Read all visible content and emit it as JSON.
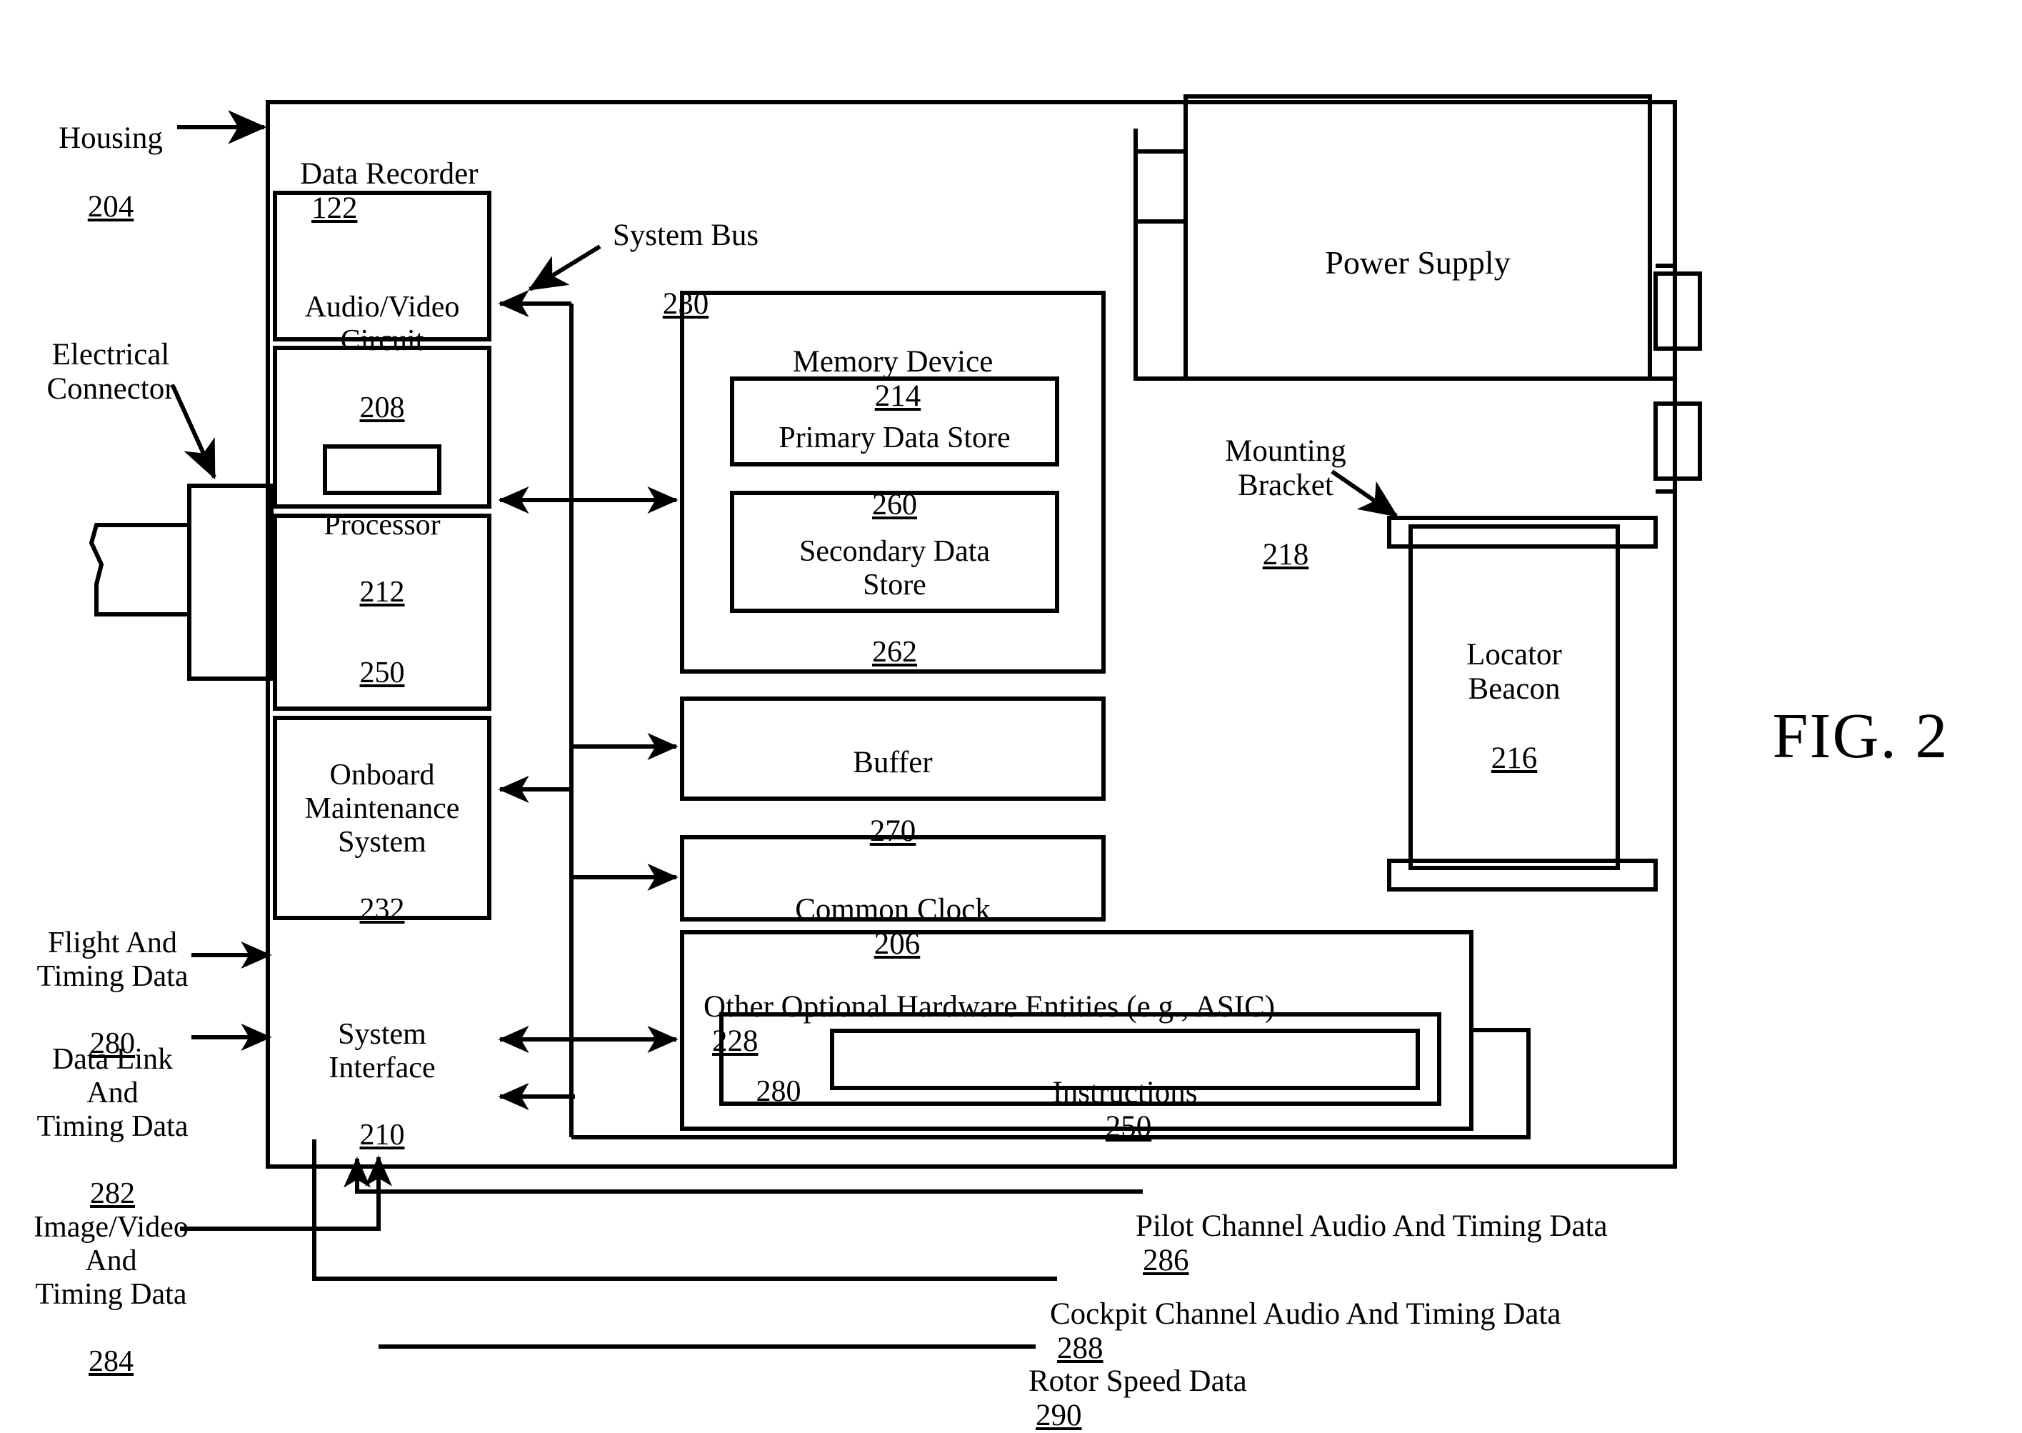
{
  "figure": {
    "caption": "FIG. 2"
  },
  "callouts": {
    "housing": {
      "name": "Housing",
      "ref": "204"
    },
    "electrical_connector": {
      "name": "Electrical\nConnector",
      "ref": ""
    },
    "system_bus": {
      "name": "System Bus",
      "ref": "230"
    },
    "mounting_bracket": {
      "name": "Mounting\nBracket",
      "ref": "218"
    }
  },
  "blocks": {
    "data_recorder": {
      "name": "Data Recorder",
      "ref": "122"
    },
    "audio_video_circuit": {
      "name": "Audio/Video\nCircuit",
      "ref": "208"
    },
    "processor": {
      "name": "Processor",
      "ref": "212"
    },
    "processor_instructions": {
      "ref": "250"
    },
    "onboard_maintenance_system": {
      "name": "Onboard\nMaintenance\nSystem",
      "ref": "232"
    },
    "system_interface": {
      "name": "System\nInterface",
      "ref": "210"
    },
    "memory_device": {
      "name": "Memory Device",
      "ref": "214"
    },
    "primary_data_store": {
      "name": "Primary Data Store",
      "ref": "260"
    },
    "secondary_data_store": {
      "name": "Secondary Data\nStore",
      "ref": "262"
    },
    "buffer": {
      "name": "Buffer",
      "ref": "270"
    },
    "common_clock": {
      "name": "Common Clock",
      "ref": "206"
    },
    "other_hardware": {
      "name": "Other Optional Hardware Entities (e.g., ASIC)",
      "ref": "228"
    },
    "hardware_inner": {
      "ref": "280"
    },
    "hardware_instructions": {
      "name": "Instructions",
      "ref": "250"
    },
    "power_supply": {
      "name": "Power Supply",
      "ref": ""
    },
    "locator_beacon": {
      "name": "Locator\nBeacon",
      "ref": "216"
    }
  },
  "signals": {
    "flight_timing": {
      "name": "Flight And\nTiming Data",
      "ref": "280"
    },
    "data_link_timing": {
      "name": "Data Link\nAnd\nTiming Data",
      "ref": "282"
    },
    "image_video_timing": {
      "name": "Image/Video\nAnd\nTiming Data",
      "ref": "284"
    },
    "pilot_channel": {
      "name": "Pilot Channel Audio And Timing Data",
      "ref": "286"
    },
    "cockpit_channel": {
      "name": "Cockpit Channel Audio And Timing Data",
      "ref": "288"
    },
    "rotor_speed": {
      "name": "Rotor Speed Data",
      "ref": "290"
    }
  }
}
